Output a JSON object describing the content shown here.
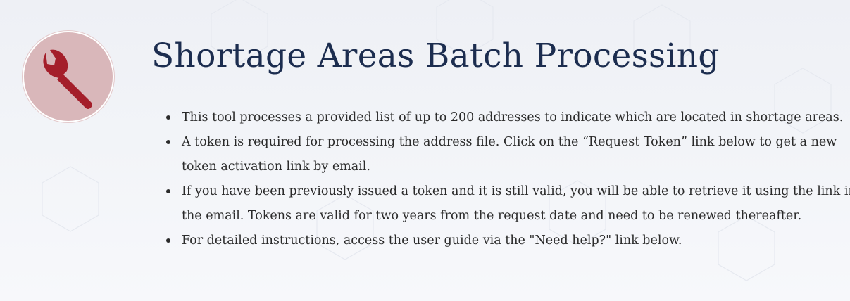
{
  "header": {
    "title": "Shortage Areas Batch Processing",
    "icon": "wrench-icon",
    "icon_colors": {
      "circle": "#d9b7ba",
      "wrench": "#a41e2a"
    }
  },
  "info": {
    "bullets": [
      "This tool processes a provided list of up to 200 addresses to indicate which are located in shortage areas.",
      "A token is required for processing the address file. Click on the “Request Token” link below to get a new token activation link by email.",
      "If you have been previously issued a token and it is still valid, you will be able to retrieve it using the link in the email. Tokens are valid for two years from the request date and need to be renewed thereafter.",
      "For detailed instructions, access the user guide via the \"Need help?\" link below."
    ]
  },
  "colors": {
    "title": "#1c2d4f",
    "body_text": "#2b2b2b",
    "background": "#eef0f5"
  }
}
